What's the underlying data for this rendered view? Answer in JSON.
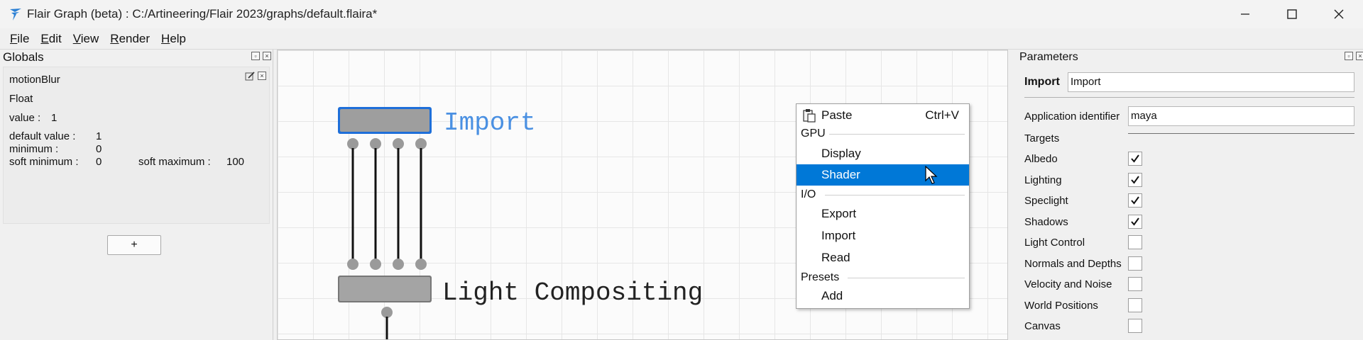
{
  "window": {
    "title": "Flair Graph (beta) : C:/Artineering/Flair 2023/graphs/default.flaira*"
  },
  "menu": {
    "file": {
      "ul": "F",
      "rest": "ile"
    },
    "edit": {
      "ul": "E",
      "rest": "dit"
    },
    "view": {
      "ul": "V",
      "rest": "iew"
    },
    "render": {
      "ul": "R",
      "rest": "ender"
    },
    "help": {
      "ul": "H",
      "rest": "elp"
    }
  },
  "globals": {
    "title": "Globals",
    "variable": {
      "name": "motionBlur",
      "type": "Float",
      "value_label": "value :",
      "value": "1",
      "default_label": "default value :",
      "default_value": "1",
      "minimum_label": "minimum  :",
      "minimum_value": "0",
      "soft_min_label": "soft minimum :",
      "soft_min_value": "0",
      "soft_max_label": "soft maximum :",
      "soft_max_value": "100"
    },
    "add_label": "+"
  },
  "graph": {
    "nodes": {
      "import": {
        "label": "Import",
        "color": "#4a90e2"
      },
      "light_compositing": {
        "label": "Light Compositing",
        "color": "#222222"
      }
    }
  },
  "context_menu": {
    "paste": {
      "label": "Paste",
      "shortcut": "Ctrl+V"
    },
    "sections": {
      "gpu": {
        "label": "GPU",
        "items": [
          "Display",
          "Shader"
        ]
      },
      "io": {
        "label": "I/O",
        "items": [
          "Export",
          "Import",
          "Read"
        ]
      },
      "presets": {
        "label": "Presets",
        "items": [
          "Add"
        ]
      }
    },
    "selected": "Shader",
    "highlight_color": "#0078d7"
  },
  "parameters": {
    "title": "Parameters",
    "node_label": "Import",
    "node_name": "Import",
    "app_id_label": "Application identifier",
    "app_id_value": "maya",
    "targets_label": "Targets",
    "targets": [
      {
        "label": "Albedo",
        "checked": true
      },
      {
        "label": "Lighting",
        "checked": true
      },
      {
        "label": "Speclight",
        "checked": true
      },
      {
        "label": "Shadows",
        "checked": true
      },
      {
        "label": "Light Control",
        "checked": false
      },
      {
        "label": "Normals and Depths",
        "checked": false
      },
      {
        "label": "Velocity and Noise",
        "checked": false
      },
      {
        "label": "World Positions",
        "checked": false
      },
      {
        "label": "Canvas",
        "checked": false
      }
    ]
  }
}
